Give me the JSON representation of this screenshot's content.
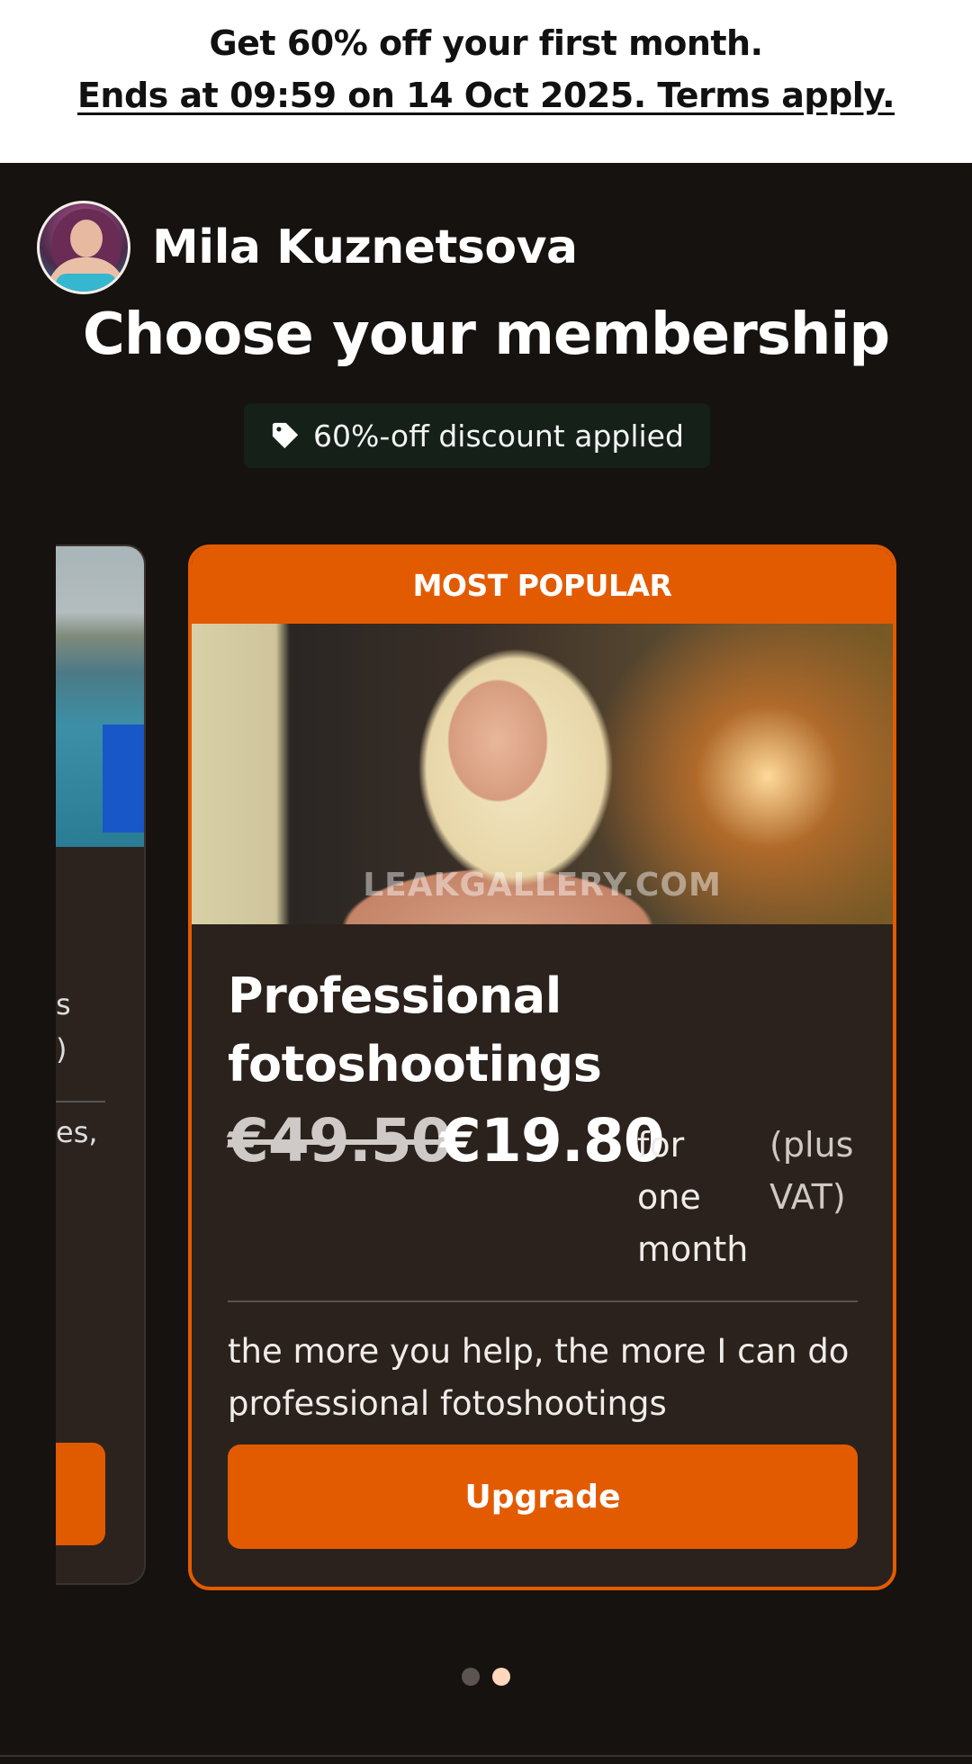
{
  "promo": {
    "line1": "Get 60% off your first month.",
    "line2": "Ends at 09:59 on 14 Oct 2025. Terms apply."
  },
  "creator": {
    "name": "Mila Kuznetsova"
  },
  "page_title": "Choose your membership",
  "discount_badge": {
    "label": "60%-off discount applied",
    "icon": "tag-icon"
  },
  "left_card": {
    "text_fragments": [
      "s",
      ")",
      "es,"
    ]
  },
  "featured_card": {
    "header": "MOST POPULAR",
    "image_watermark": "LEAKGALLERY.COM",
    "title": "Professional fotoshootings",
    "old_price": "€49.50",
    "new_price": "€19.80",
    "period": "for one month",
    "vat": "(plus VAT)",
    "description": "the more you help, the more I can do professional fotoshootings",
    "cta": "Upgrade"
  },
  "pager": {
    "count": 2,
    "active_index": 1
  },
  "colors": {
    "accent": "#e35b00",
    "background": "#161210",
    "card": "#2b221d",
    "badge_bg": "#142018"
  }
}
